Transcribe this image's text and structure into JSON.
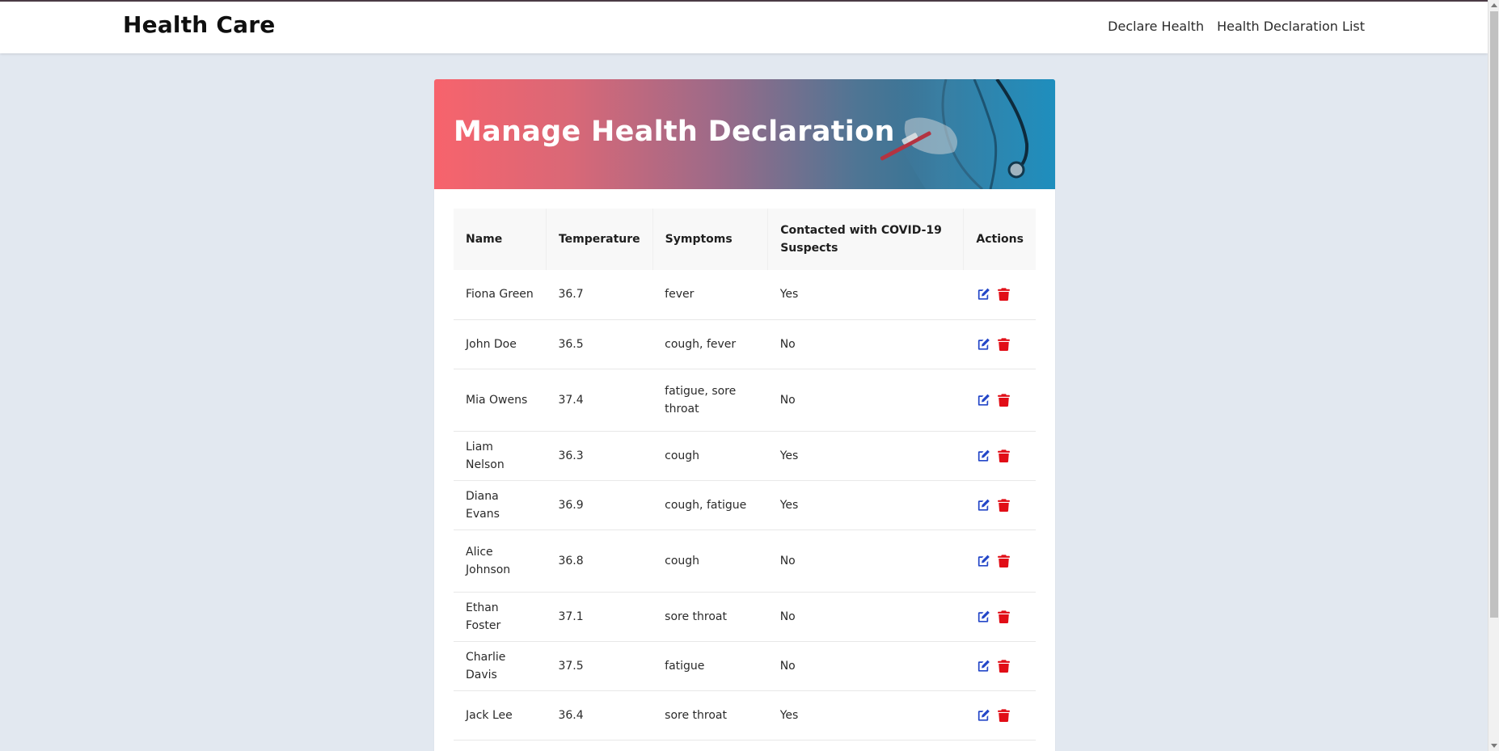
{
  "navbar": {
    "brand": "Health Care",
    "links": [
      "Declare Health",
      "Health Declaration List"
    ]
  },
  "hero": {
    "title": "Manage Health Declaration"
  },
  "table": {
    "headers": [
      "Name",
      "Temperature",
      "Symptoms",
      "Contacted with COVID-19 Suspects",
      "Actions"
    ],
    "rows": [
      {
        "name": "Fiona Green",
        "temperature": "36.7",
        "symptoms": "fever",
        "contacted": "Yes"
      },
      {
        "name": "John Doe",
        "temperature": "36.5",
        "symptoms": "cough, fever",
        "contacted": "No"
      },
      {
        "name": "Mia Owens",
        "temperature": "37.4",
        "symptoms": "fatigue, sore throat",
        "contacted": "No"
      },
      {
        "name": "Liam Nelson",
        "temperature": "36.3",
        "symptoms": "cough",
        "contacted": "Yes"
      },
      {
        "name": "Diana Evans",
        "temperature": "36.9",
        "symptoms": "cough, fatigue",
        "contacted": "Yes"
      },
      {
        "name": "Alice Johnson",
        "temperature": "36.8",
        "symptoms": "cough",
        "contacted": "No"
      },
      {
        "name": "Ethan Foster",
        "temperature": "37.1",
        "symptoms": "sore throat",
        "contacted": "No"
      },
      {
        "name": "Charlie Davis",
        "temperature": "37.5",
        "symptoms": "fatigue",
        "contacted": "No"
      },
      {
        "name": "Jack Lee",
        "temperature": "36.4",
        "symptoms": "sore throat",
        "contacted": "Yes"
      }
    ]
  },
  "icons": {
    "edit": "edit-icon",
    "delete": "trash-icon"
  },
  "colors": {
    "background": "#e2e8f0",
    "edit_icon": "#2447c8",
    "delete_icon": "#e10e17",
    "hero_gradient_start": "#f7636c",
    "hero_gradient_end": "#1d86b0"
  }
}
